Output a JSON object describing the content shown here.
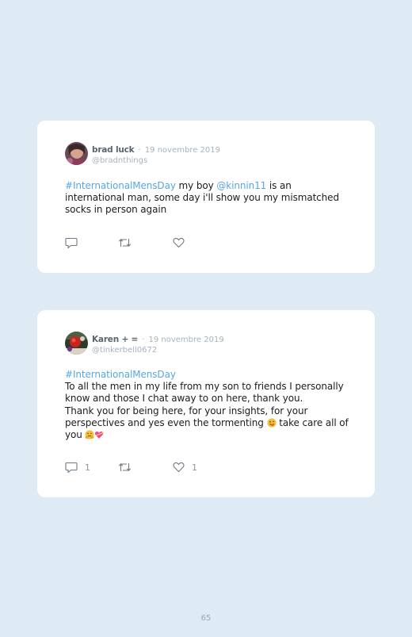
{
  "tweets": [
    {
      "author": "brad luck",
      "separator": "·",
      "date": "19 novembre 2019",
      "handle": "@bradnthings",
      "text": {
        "hashtag": "#InternationalMensDay",
        "part1": " my boy ",
        "mention": "@kinnin11",
        "part2": " is an international man, some day i'll show you my mismatched socks in person again"
      },
      "replies": "",
      "retweets": "",
      "likes": ""
    },
    {
      "author": "Karen + =",
      "separator": "·",
      "date": "19 novembre 2019",
      "handle": "@tinkerbell0672",
      "text": {
        "hashtag": "#InternationalMensDay",
        "line1": "To all the men in my life from my son to friends I personally know and those I chat away to on here, thank you.",
        "line2": "Thank you for being here, for your insights, for your perspectives and yes even the tormenting ",
        "line3": " take care all of you "
      },
      "replies": "1",
      "retweets": "",
      "likes": "1"
    }
  ],
  "icons": {
    "reply": "reply-icon",
    "retweet": "retweet-icon",
    "like": "heart-icon",
    "emoji_wink": "winking-face-tongue-emoji",
    "emoji_hug": "hugging-face-emoji",
    "emoji_hearts": "heart-with-ribbon-emoji"
  },
  "colors": {
    "page_background": "#deebf4",
    "card_background": "#ffffff",
    "link": "#57a7e0",
    "meta": "#a7b2bd"
  },
  "page_number": "65"
}
